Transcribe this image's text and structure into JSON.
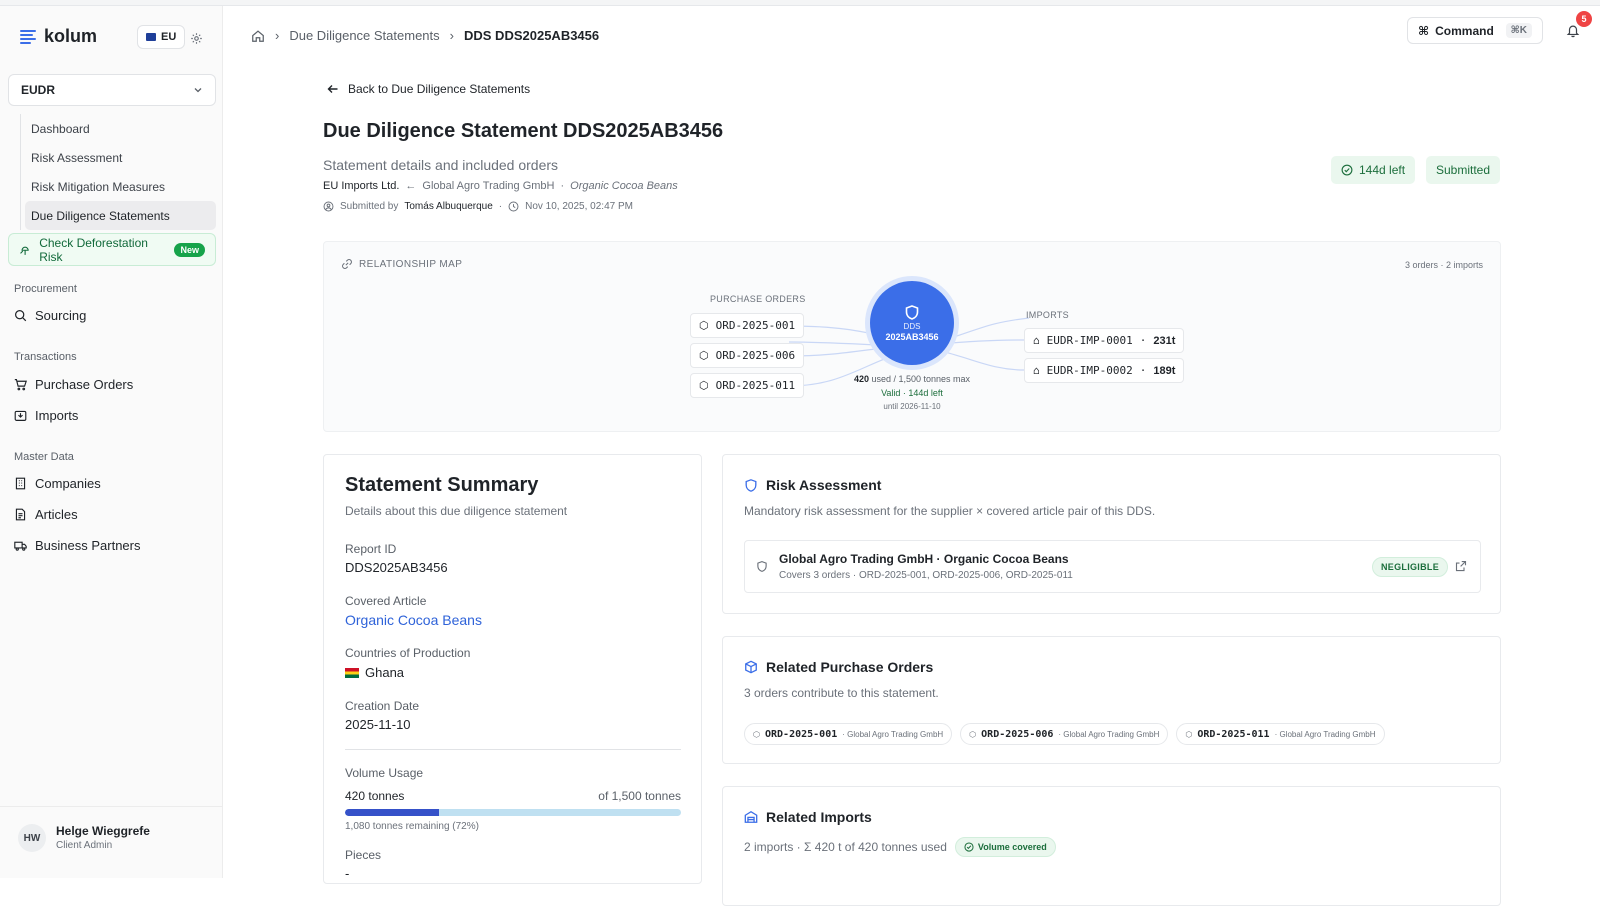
{
  "app": {
    "brand": "kolum",
    "region": "EU"
  },
  "sidebar": {
    "module": "EUDR",
    "module_items": [
      {
        "label": "Dashboard"
      },
      {
        "label": "Risk Assessment"
      },
      {
        "label": "Risk Mitigation Measures"
      },
      {
        "label": "Due Diligence Statements",
        "active": true
      }
    ],
    "check_risk": {
      "label": "Check Deforestation Risk",
      "badge": "New"
    },
    "groups": {
      "procurement": {
        "label": "Procurement",
        "items": [
          {
            "label": "Sourcing",
            "icon": "search-icon"
          }
        ]
      },
      "transactions": {
        "label": "Transactions",
        "items": [
          {
            "label": "Purchase Orders",
            "icon": "cart-icon"
          },
          {
            "label": "Imports",
            "icon": "import-icon"
          }
        ]
      },
      "master_data": {
        "label": "Master Data",
        "items": [
          {
            "label": "Companies",
            "icon": "building-icon"
          },
          {
            "label": "Articles",
            "icon": "document-icon"
          },
          {
            "label": "Business Partners",
            "icon": "truck-icon"
          }
        ]
      }
    },
    "user": {
      "initials": "HW",
      "name": "Helge Wieggrefe",
      "role": "Client Admin"
    }
  },
  "header": {
    "breadcrumb": [
      "Due Diligence Statements",
      "DDS DDS2025AB3456"
    ],
    "command_label": "Command",
    "command_shortcut": "⌘K",
    "notifications": "5"
  },
  "page": {
    "back_label": "Back to Due Diligence Statements",
    "title": "Due Diligence Statement DDS2025AB3456",
    "subtitle": "Statement details and included orders",
    "buyer": "EU Imports Ltd.",
    "arrow": "←",
    "supplier": "Global Agro Trading GmbH",
    "sep": "·",
    "article": "Organic Cocoa Beans",
    "submitted_by_label": "Submitted by",
    "submitted_by": "Tomás Albuquerque",
    "submitted_at": "Nov 10, 2025, 02:47 PM",
    "days_left": "144d left",
    "status": "Submitted"
  },
  "map": {
    "title": "RELATIONSHIP MAP",
    "meta": "3 orders · 2 imports",
    "po_label": "PURCHASE ORDERS",
    "imports_label": "IMPORTS",
    "orders": [
      "ORD-2025-001",
      "ORD-2025-006",
      "ORD-2025-011"
    ],
    "imports": [
      {
        "id": "EUDR-IMP-0001",
        "tons": "231t"
      },
      {
        "id": "EUDR-IMP-0002",
        "tons": "189t"
      }
    ],
    "hub_label": "DDS",
    "hub_id": "2025AB3456",
    "used": "420",
    "used_suffix": "used / 1,500 tonnes max",
    "valid": "Valid · 144d left",
    "until": "until 2026-11-10"
  },
  "summary": {
    "title": "Statement Summary",
    "subtitle": "Details about this due diligence statement",
    "report_id_label": "Report ID",
    "report_id": "DDS2025AB3456",
    "covered_article_label": "Covered Article",
    "covered_article": "Organic Cocoa Beans",
    "countries_label": "Countries of Production",
    "country": "Ghana",
    "creation_date_label": "Creation Date",
    "creation_date": "2025-11-10",
    "volume_label": "Volume Usage",
    "volume_used": "420 tonnes",
    "volume_max": "of 1,500 tonnes",
    "volume_fraction": 0.28,
    "volume_remaining": "1,080 tonnes remaining (72%)",
    "pieces_label": "Pieces",
    "pieces": "-"
  },
  "risk": {
    "title": "Risk Assessment",
    "subtitle": "Mandatory risk assessment for the supplier × covered article pair of this DDS.",
    "row_name": "Global Agro Trading GmbH · Organic Cocoa Beans",
    "row_covers": "Covers 3 orders · ORD-2025-001, ORD-2025-006, ORD-2025-011",
    "level": "NEGLIGIBLE"
  },
  "related_pos": {
    "title": "Related Purchase Orders",
    "subtitle": "3 orders contribute to this statement.",
    "items": [
      {
        "code": "ORD-2025-001",
        "partner": "· Global Agro Trading GmbH"
      },
      {
        "code": "ORD-2025-006",
        "partner": "· Global Agro Trading GmbH"
      },
      {
        "code": "ORD-2025-011",
        "partner": "· Global Agro Trading GmbH"
      }
    ]
  },
  "related_imports": {
    "title": "Related Imports",
    "subtitle": "2 imports · Σ 420 t of 420 tonnes used",
    "badge": "Volume covered"
  },
  "colors": {
    "accent": "#3b6ee8",
    "success": "#1c6e3c",
    "progress": "#3551c9"
  }
}
